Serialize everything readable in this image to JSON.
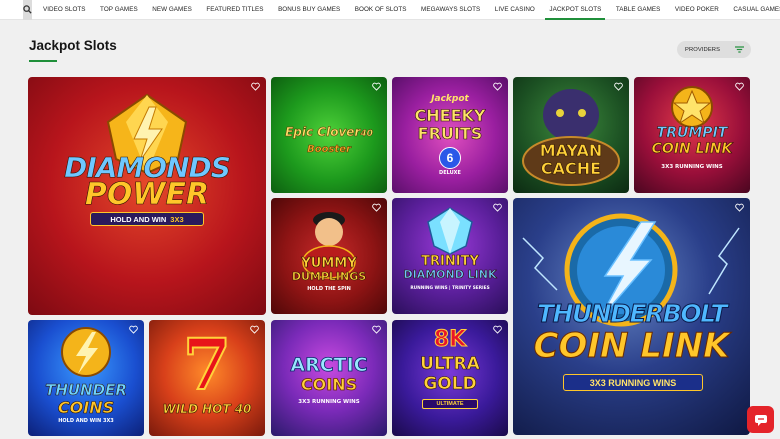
{
  "nav": {
    "search_icon": "search-icon",
    "items": [
      "VIDEO SLOTS",
      "TOP GAMES",
      "NEW GAMES",
      "FEATURED TITLES",
      "BONUS BUY GAMES",
      "BOOK OF SLOTS",
      "MEGAWAYS SLOTS",
      "LIVE CASINO",
      "JACKPOT SLOTS",
      "TABLE GAMES",
      "VIDEO POKER",
      "CASUAL GAMES"
    ],
    "active": "JACKPOT SLOTS"
  },
  "page": {
    "title": "Jackpot Slots"
  },
  "providers": {
    "label": "PROVIDERS",
    "icon": "filter-icon"
  },
  "games": {
    "diamonds_power": {
      "line1": "DIAMONDS",
      "line2": "POWER",
      "sub": "HOLD AND WIN",
      "tag": "3X3"
    },
    "epic_clover": {
      "line1": "Epic Clover",
      "num": "40",
      "sub": "Booster"
    },
    "cheeky_fruits": {
      "pre": "Jackpot",
      "line1": "CHEEKY",
      "line2": "FRUITS",
      "num": "6",
      "sub": "DELUXE"
    },
    "mayan_cache": {
      "line1": "MAYAN",
      "line2": "CACHE"
    },
    "trump_it": {
      "line1": "TRUMPIT",
      "line2": "COIN LINK",
      "sub": "3X3 RUNNING WINS"
    },
    "yummy_dumplings": {
      "line1": "YUMMY",
      "line2": "DUMPLINGS",
      "sub": "HOLD THE SPIN"
    },
    "trinity": {
      "line1": "TRINITY",
      "line2": "DIAMOND LINK",
      "sub": "RUNNING WINS | TRINITY SERIES"
    },
    "thunderbolt": {
      "line1": "THUNDERBOLT",
      "line2": "COIN LINK",
      "sub": "3X3 RUNNING WINS"
    },
    "thunder_coins": {
      "line1": "THUNDER",
      "line2": "COINS",
      "sub": "HOLD AND WIN 3X3"
    },
    "wild_hot": {
      "num": "7",
      "line1": "WILD HOT 40"
    },
    "arctic_coins": {
      "line1": "ARCTIC",
      "line2": "COINS",
      "sub": "3X3 RUNNING WINS"
    },
    "ultra_gold": {
      "num": "8K",
      "line1": "ULTRA",
      "line2": "GOLD",
      "sub": "ULTIMATE"
    }
  },
  "colors": {
    "accent": "#1f8f3a",
    "chat": "#e4242a"
  }
}
